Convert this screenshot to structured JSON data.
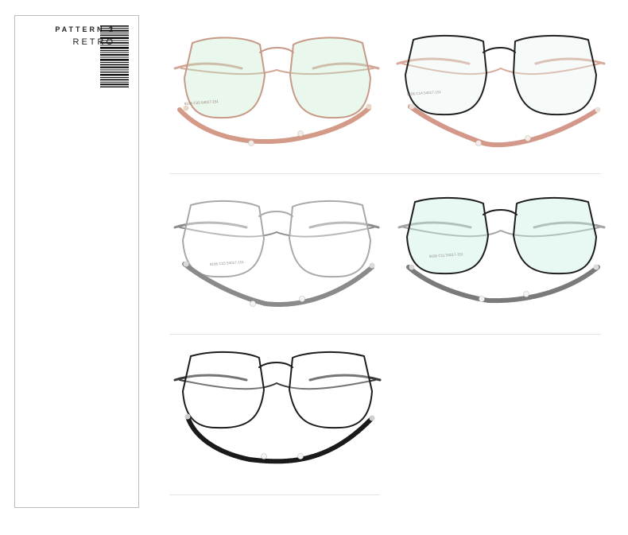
{
  "side_panel": {
    "pattern_label": "PATTERN 2",
    "style_label": "RETRO",
    "barcode_icon": "barcode-icon"
  },
  "products": [
    {
      "variant": "rose-gold",
      "spec": "9186 C20 54017-151",
      "frame_color": "#c79a88",
      "temple_color": "#d4a899",
      "chain_color": "#d39a88",
      "lens_tint": "#bfe9c8"
    },
    {
      "variant": "black-rose-gold",
      "spec": "9186 C14 54017-151",
      "frame_color": "#202020",
      "temple_color": "#d7a99a",
      "chain_color": "#d4988a",
      "lens_tint": "#e6f1ea"
    },
    {
      "variant": "silver",
      "spec": "9186 C15 54017-151",
      "frame_color": "#a9a9a9",
      "temple_color": "#8c8c8c",
      "chain_color": "#8a8a8a",
      "lens_tint": "#ffffff"
    },
    {
      "variant": "black-silver",
      "spec": "9186 C11 54017-151",
      "frame_color": "#1e1e1e",
      "temple_color": "#a4a4a4",
      "chain_color": "#7a7a7a",
      "lens_tint": "#c6f0e2"
    },
    {
      "variant": "black",
      "spec": "",
      "frame_color": "#1d1d1d",
      "temple_color": "#3a3a3a",
      "chain_color": "#1a1a1a",
      "lens_tint": "#ffffff"
    }
  ]
}
